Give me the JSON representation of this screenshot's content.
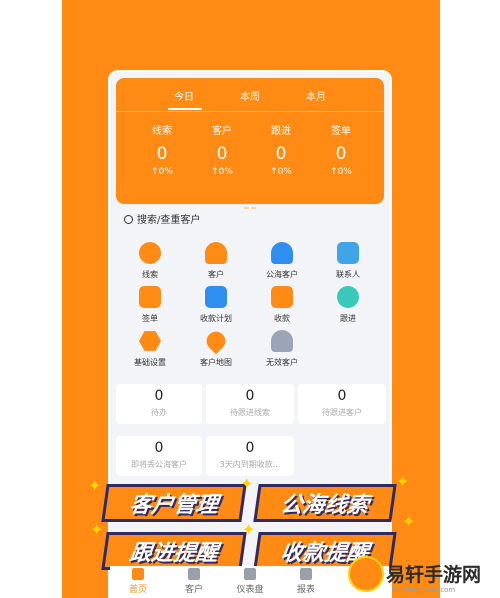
{
  "stats_card": {
    "tabs": [
      "今日",
      "本周",
      "本月"
    ],
    "active_tab": 0,
    "items": [
      {
        "label": "线索",
        "value": "0",
        "change": "↑0%"
      },
      {
        "label": "客户",
        "value": "0",
        "change": "↑0%"
      },
      {
        "label": "跟进",
        "value": "0",
        "change": "↑0%"
      },
      {
        "label": "签单",
        "value": "0",
        "change": "↑0%"
      }
    ]
  },
  "search": {
    "placeholder": "搜索/查重客户"
  },
  "grid": [
    {
      "label": "线索",
      "icon": "clue-icon",
      "color": "#ff8b14"
    },
    {
      "label": "客户",
      "icon": "customer-icon",
      "color": "#ff8b14"
    },
    {
      "label": "公海客户",
      "icon": "public-sea-customer-icon",
      "color": "#2f8ff0"
    },
    {
      "label": "联系人",
      "icon": "contact-icon",
      "color": "#3fa4e8"
    },
    {
      "label": "签单",
      "icon": "contract-icon",
      "color": "#ff8b14"
    },
    {
      "label": "收款计划",
      "icon": "payment-plan-icon",
      "color": "#2f8ff0"
    },
    {
      "label": "收款",
      "icon": "payment-icon",
      "color": "#ff8b14"
    },
    {
      "label": "跟进",
      "icon": "follow-up-icon",
      "color": "#3ac9b8"
    },
    {
      "label": "基础设置",
      "icon": "settings-icon",
      "color": "#ff8b14"
    },
    {
      "label": "客户地图",
      "icon": "map-pin-icon",
      "color": "#ff8b14"
    },
    {
      "label": "无效客户",
      "icon": "invalid-customer-icon",
      "color": "#9aa6b8"
    }
  ],
  "tiles": [
    {
      "value": "0",
      "label": "待办"
    },
    {
      "value": "0",
      "label": "待跟进线索"
    },
    {
      "value": "0",
      "label": "待跟进客户"
    },
    {
      "value": "0",
      "label": "即将丢公海客户"
    },
    {
      "value": "0",
      "label": "3天内到期收款..."
    }
  ],
  "banners": [
    "客户管理",
    "公海线索",
    "跟进提醒",
    "收款提醒"
  ],
  "bottom_nav": [
    {
      "label": "首页",
      "icon": "home-icon"
    },
    {
      "label": "客户",
      "icon": "grid-icon"
    },
    {
      "label": "仪表盘",
      "icon": "dashboard-icon"
    },
    {
      "label": "报表",
      "icon": "report-icon"
    }
  ],
  "watermark": {
    "title": "易轩手游网",
    "url": "ibudongguan.com"
  }
}
